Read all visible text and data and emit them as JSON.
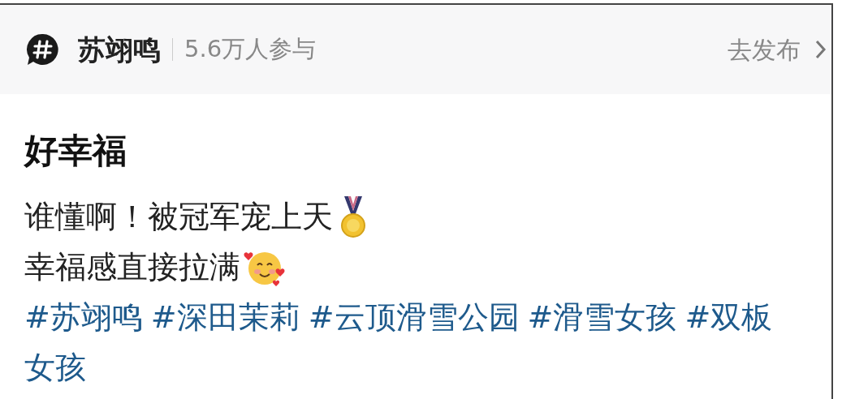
{
  "topic": {
    "title": "苏翊鸣",
    "participants": "5.6万人参与",
    "action": "去发布"
  },
  "post": {
    "title": "好幸福",
    "lines": [
      {
        "text": "谁懂啊！被冠军宠上天",
        "kind": "medal"
      },
      {
        "text": "幸福感直接拉满",
        "kind": "hearts-face"
      }
    ],
    "hashtag_lines": [
      [
        "#苏翊鸣",
        "#深田茉莉",
        "#云顶滑雪公园",
        "#滑雪女孩",
        "#双板"
      ],
      [
        "女孩"
      ]
    ]
  }
}
